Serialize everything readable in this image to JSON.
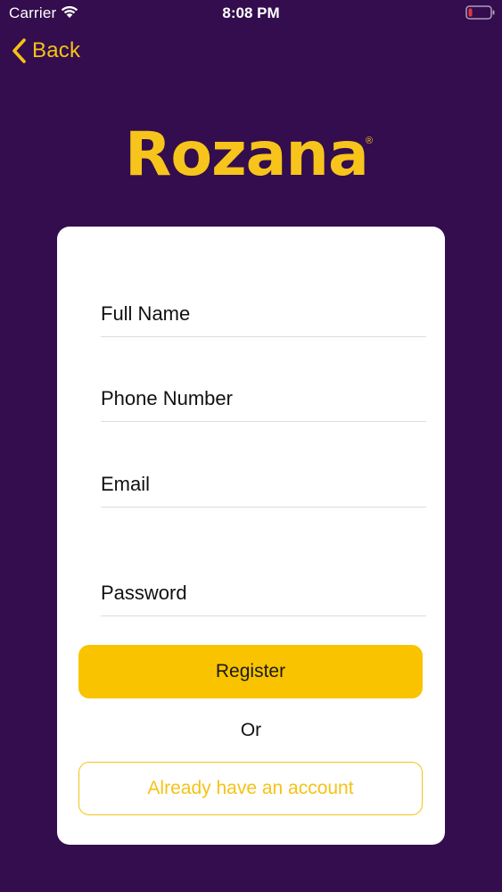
{
  "status_bar": {
    "carrier": "Carrier",
    "time": "8:08 PM",
    "wifi_icon": "wifi-icon",
    "battery_icon": "battery-low-icon"
  },
  "nav": {
    "back_label": "Back",
    "back_icon": "chevron-left-icon"
  },
  "brand": {
    "name": "Rozana",
    "registered_mark": "®",
    "color": "#F7C41B"
  },
  "form": {
    "fields": [
      {
        "label": "Full Name",
        "value": ""
      },
      {
        "label": "Phone Number",
        "value": ""
      },
      {
        "label": "Email",
        "value": ""
      },
      {
        "label": "Password",
        "value": ""
      }
    ],
    "register_label": "Register",
    "or_label": "Or",
    "login_label": "Already have an account"
  },
  "colors": {
    "background": "#330D4E",
    "accent": "#F9C300",
    "card": "#FFFFFF"
  }
}
